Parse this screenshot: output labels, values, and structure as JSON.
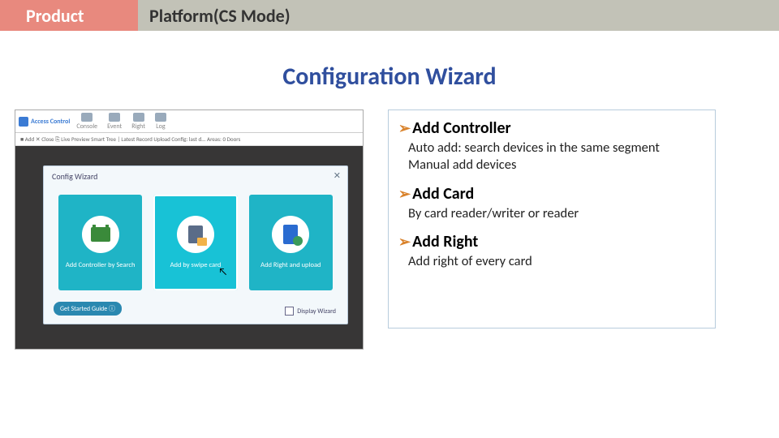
{
  "header": {
    "left": "Product",
    "right": "Platform(CS Mode)"
  },
  "title": "Configuration Wizard",
  "shot": {
    "app": "Access Control",
    "tbar": [
      "Console",
      "Event",
      "Right",
      "Log"
    ],
    "sbar": "■ Add   ✕ Close   ⎘ Live Preview   Smart Tree |   Latest Record Upload Config: last d...     Areas:  0  Doors",
    "wiz": {
      "title": "Config Wizard",
      "cards": [
        "Add Controller by Search",
        "Add by swipe card",
        "Add Right and upload"
      ],
      "gsg": "Get Started Guide ⓘ",
      "dsp": "Display Wizard"
    }
  },
  "info": {
    "s1": {
      "h": "Add Controller",
      "b": "   Auto add: search devices in the same segment\n   Manual add devices"
    },
    "s2": {
      "h": "Add Card",
      "b": "   By card reader/writer or reader"
    },
    "s3": {
      "h": "Add Right",
      "b": "   Add right of every card"
    }
  }
}
